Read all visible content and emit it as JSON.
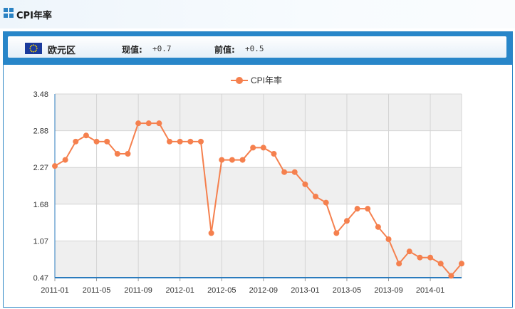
{
  "page": {
    "title": "CPI年率"
  },
  "info": {
    "region": "欧元区",
    "current_label": "现值:",
    "current_value": "+0.7",
    "previous_label": "前值:",
    "previous_value": "+0.5"
  },
  "colors": {
    "accent": "#2886c9",
    "series": "#f5804e",
    "band": "#efefef"
  },
  "chart_data": {
    "type": "line",
    "legend": "top",
    "grid": true,
    "series": [
      {
        "name": "CPI年率",
        "values": [
          2.3,
          2.4,
          2.7,
          2.8,
          2.7,
          2.7,
          2.5,
          2.5,
          3.0,
          3.0,
          3.0,
          2.7,
          2.7,
          2.7,
          2.7,
          1.2,
          2.4,
          2.4,
          2.4,
          2.6,
          2.6,
          2.5,
          2.2,
          2.2,
          2.0,
          1.8,
          1.7,
          1.2,
          1.4,
          1.6,
          1.6,
          1.3,
          1.1,
          0.7,
          0.9,
          0.8,
          0.8,
          0.7,
          0.5,
          0.7
        ]
      }
    ],
    "x_tick_labels": [
      "2011-01",
      "2011-05",
      "2011-09",
      "2012-01",
      "2012-05",
      "2012-09",
      "2013-01",
      "2013-05",
      "2013-09",
      "2014-01"
    ],
    "y_tick_labels": [
      "3.48",
      "2.88",
      "2.27",
      "1.68",
      "1.07",
      "0.47"
    ],
    "ylim": [
      0.47,
      3.48
    ]
  }
}
